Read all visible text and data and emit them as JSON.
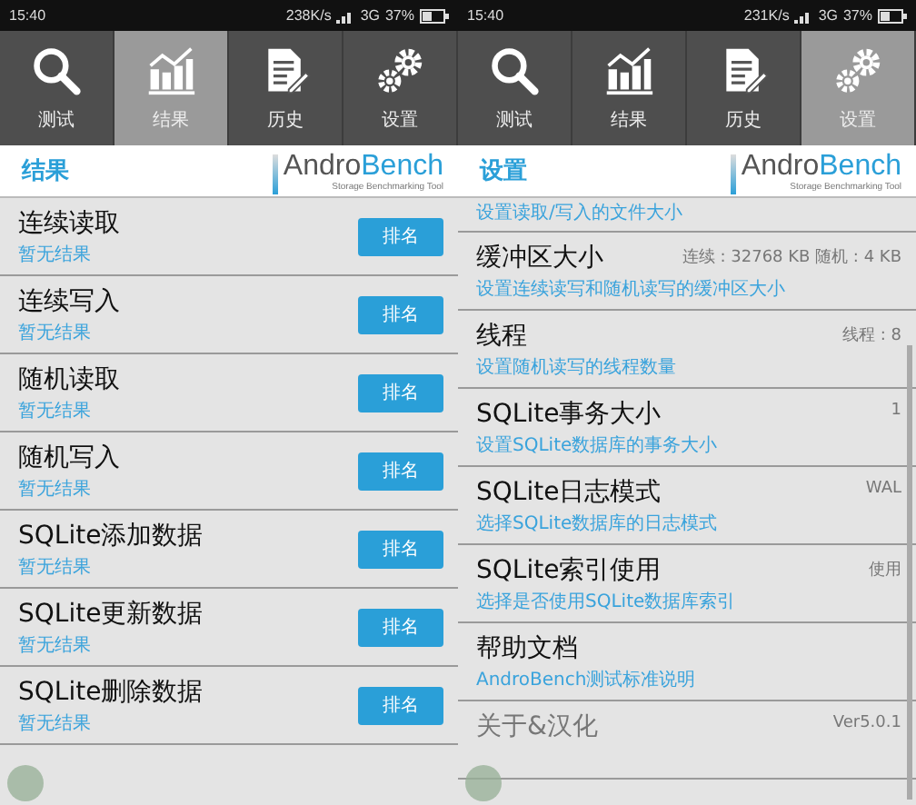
{
  "panels": [
    {
      "status_bar": {
        "time": "15:40",
        "speed": "238K/s",
        "network": "3G",
        "battery": "37%"
      },
      "tabs": [
        {
          "kind": "search",
          "label": "测试",
          "selected": false
        },
        {
          "kind": "chart",
          "label": "结果",
          "selected": true
        },
        {
          "kind": "document",
          "label": "历史",
          "selected": false
        },
        {
          "kind": "gear",
          "label": "设置",
          "selected": false
        }
      ],
      "header": {
        "title": "结果",
        "logo_part1": "Andro",
        "logo_part2": "Bench",
        "logo_tagline": "Storage Benchmarking Tool"
      },
      "rows": [
        {
          "kind": "result",
          "title": "连续读取",
          "subtitle": "暂无结果",
          "button": "排名"
        },
        {
          "kind": "result",
          "title": "连续写入",
          "subtitle": "暂无结果",
          "button": "排名"
        },
        {
          "kind": "result",
          "title": "随机读取",
          "subtitle": "暂无结果",
          "button": "排名"
        },
        {
          "kind": "result",
          "title": "随机写入",
          "subtitle": "暂无结果",
          "button": "排名"
        },
        {
          "kind": "result",
          "title": "SQLite添加数据",
          "subtitle": "暂无结果",
          "button": "排名"
        },
        {
          "kind": "result",
          "title": "SQLite更新数据",
          "subtitle": "暂无结果",
          "button": "排名"
        },
        {
          "kind": "result",
          "title": "SQLite删除数据",
          "subtitle": "暂无结果",
          "button": "排名"
        }
      ]
    },
    {
      "status_bar": {
        "time": "15:40",
        "speed": "231K/s",
        "network": "3G",
        "battery": "37%"
      },
      "tabs": [
        {
          "kind": "search",
          "label": "测试",
          "selected": false
        },
        {
          "kind": "chart",
          "label": "结果",
          "selected": false
        },
        {
          "kind": "document",
          "label": "历史",
          "selected": false
        },
        {
          "kind": "gear",
          "label": "设置",
          "selected": true
        }
      ],
      "header": {
        "title": "设置",
        "logo_part1": "Andro",
        "logo_part2": "Bench",
        "logo_tagline": "Storage Benchmarking Tool"
      },
      "rows": [
        {
          "kind": "partial",
          "subtitle": "设置读取/写入的文件大小"
        },
        {
          "kind": "setting",
          "title": "缓冲区大小",
          "subtitle": "设置连续读写和随机读写的缓冲区大小",
          "value": "连续 : 32768 KB  随机 : 4 KB",
          "disabled": false
        },
        {
          "kind": "setting",
          "title": "线程",
          "subtitle": "设置随机读写的线程数量",
          "value": "线程 : 8",
          "disabled": false
        },
        {
          "kind": "setting",
          "title": "SQLite事务大小",
          "subtitle": "设置SQLite数据库的事务大小",
          "value": "1",
          "disabled": false
        },
        {
          "kind": "setting",
          "title": "SQLite日志模式",
          "subtitle": "选择SQLite数据库的日志模式",
          "value": "WAL",
          "disabled": false
        },
        {
          "kind": "setting",
          "title": "SQLite索引使用",
          "subtitle": "选择是否使用SQLite数据库索引",
          "value": "使用",
          "disabled": false
        },
        {
          "kind": "setting",
          "title": "帮助文档",
          "subtitle": "AndroBench测试标准说明",
          "disabled": false
        },
        {
          "kind": "setting",
          "title": "关于&汉化",
          "value": "Ver5.0.1",
          "disabled": true
        }
      ]
    }
  ]
}
